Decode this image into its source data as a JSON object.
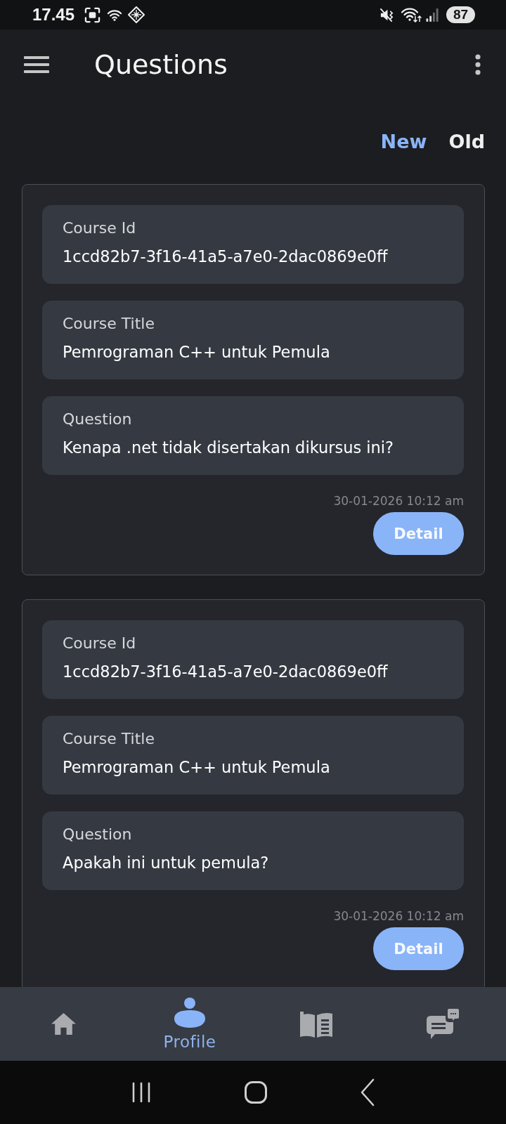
{
  "status_bar": {
    "time": "17.45",
    "battery": "87"
  },
  "app_bar": {
    "title": "Questions"
  },
  "filter_tabs": [
    {
      "label": "New",
      "selected": true
    },
    {
      "label": "Old",
      "selected": false
    }
  ],
  "questions": [
    {
      "fields": [
        {
          "label": "Course Id",
          "value": "1ccd82b7-3f16-41a5-a7e0-2dac0869e0ff"
        },
        {
          "label": "Course Title",
          "value": "Pemrograman C++ untuk Pemula"
        },
        {
          "label": "Question",
          "value": "Kenapa .net tidak disertakan dikursus ini?"
        }
      ],
      "timestamp": "30-01-2026 10:12 am",
      "action": "Detail"
    },
    {
      "fields": [
        {
          "label": "Course Id",
          "value": "1ccd82b7-3f16-41a5-a7e0-2dac0869e0ff"
        },
        {
          "label": "Course Title",
          "value": "Pemrograman C++ untuk Pemula"
        },
        {
          "label": "Question",
          "value": "Apakah ini untuk pemula?"
        }
      ],
      "timestamp": "30-01-2026 10:12 am",
      "action": "Detail"
    }
  ],
  "bottom_nav": [
    {
      "selected": false
    },
    {
      "label": "Profile",
      "selected": true
    },
    {
      "selected": false
    },
    {
      "selected": false
    }
  ]
}
